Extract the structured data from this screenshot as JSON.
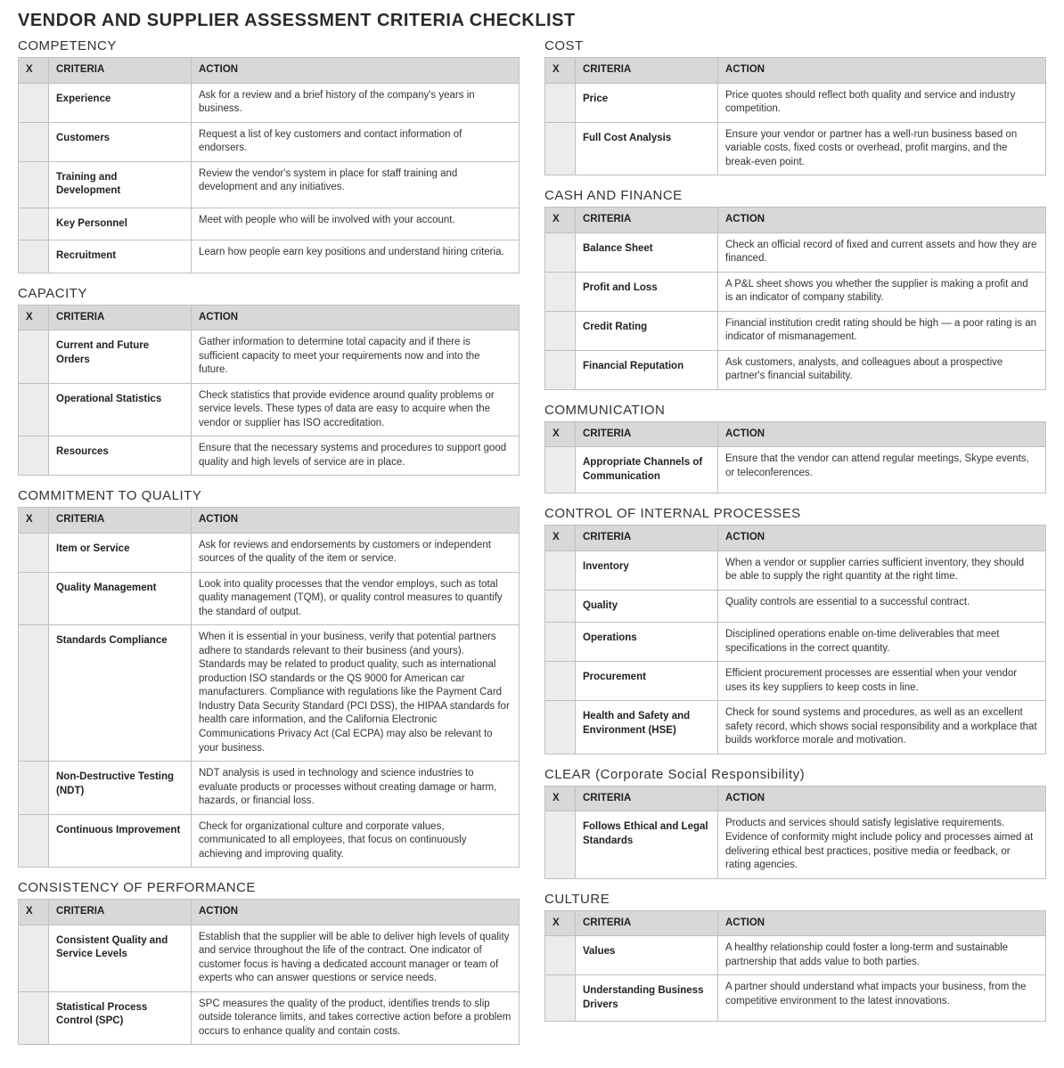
{
  "title": "VENDOR AND SUPPLIER ASSESSMENT CRITERIA CHECKLIST",
  "headers": {
    "x": "X",
    "criteria": "CRITERIA",
    "action": "ACTION"
  },
  "left": [
    {
      "title": "COMPETENCY",
      "rows": [
        {
          "criteria": "Experience",
          "action": "Ask for a review and a brief history of the company's years in business."
        },
        {
          "criteria": "Customers",
          "action": "Request a list of key customers and contact information of endorsers."
        },
        {
          "criteria": "Training and Development",
          "action": "Review the vendor's system in place for staff training and development and any initiatives."
        },
        {
          "criteria": "Key Personnel",
          "action": "Meet with people who will be involved with your account."
        },
        {
          "criteria": "Recruitment",
          "action": "Learn how people earn key positions and understand hiring criteria."
        }
      ]
    },
    {
      "title": "CAPACITY",
      "rows": [
        {
          "criteria": "Current and Future Orders",
          "action": "Gather information to determine total capacity and if there is sufficient capacity to meet your requirements now and into the future."
        },
        {
          "criteria": "Operational Statistics",
          "action": "Check statistics that provide evidence around quality problems or service levels. These types of data are easy to acquire when the vendor or supplier has ISO accreditation."
        },
        {
          "criteria": "Resources",
          "action": "Ensure that the necessary systems and procedures to support good quality and high levels of service are in place."
        }
      ]
    },
    {
      "title": "COMMITMENT TO QUALITY",
      "rows": [
        {
          "criteria": "Item or Service",
          "action": "Ask for reviews and endorsements by customers or independent sources of the quality of the item or service."
        },
        {
          "criteria": "Quality Management",
          "action": "Look into quality processes that the vendor employs, such as total quality management (TQM), or quality control measures to quantify the standard of output."
        },
        {
          "criteria": "Standards Compliance",
          "action": "When it is essential in your business, verify that potential partners adhere to standards relevant to their business (and yours). Standards may be related to product quality, such as international production ISO standards or the QS 9000 for American car manufacturers. Compliance with regulations like the Payment Card Industry Data Security Standard (PCI DSS), the HIPAA standards for health care information, and the California Electronic Communications Privacy Act (Cal ECPA) may also be relevant to your business."
        },
        {
          "criteria": "Non-Destructive Testing (NDT)",
          "action": "NDT analysis is used in technology and science industries to evaluate products or processes without creating damage or harm, hazards, or financial loss."
        },
        {
          "criteria": "Continuous Improvement",
          "action": "Check for organizational culture and corporate values, communicated to all employees, that focus on continuously achieving and improving quality."
        }
      ]
    },
    {
      "title": "CONSISTENCY OF PERFORMANCE",
      "rows": [
        {
          "criteria": "Consistent Quality and Service Levels",
          "action": "Establish that the supplier will be able to deliver high levels of quality and service throughout the life of the contract. One indicator of customer focus is having a dedicated account manager or team of experts who can answer questions or service needs."
        },
        {
          "criteria": "Statistical Process Control (SPC)",
          "action": "SPC measures the quality of the product, identifies trends to slip outside tolerance limits, and takes corrective action before a problem occurs to enhance quality and contain costs."
        }
      ]
    }
  ],
  "right": [
    {
      "title": "COST",
      "rows": [
        {
          "criteria": "Price",
          "action": "Price quotes should reflect both quality and service and industry competition."
        },
        {
          "criteria": "Full Cost Analysis",
          "action": "Ensure your vendor or partner has a well-run business based on variable costs, fixed costs or overhead, profit margins, and the break-even point."
        }
      ]
    },
    {
      "title": "CASH AND FINANCE",
      "rows": [
        {
          "criteria": "Balance Sheet",
          "action": "Check an official record of fixed and current assets and how they are financed."
        },
        {
          "criteria": "Profit and Loss",
          "action": "A P&L sheet shows you whether the supplier is making a profit and is an indicator of company stability."
        },
        {
          "criteria": "Credit Rating",
          "action": "Financial institution credit rating should be high — a poor rating is an indicator of mismanagement."
        },
        {
          "criteria": "Financial Reputation",
          "action": "Ask customers, analysts, and colleagues about a prospective partner's financial suitability."
        }
      ]
    },
    {
      "title": "COMMUNICATION",
      "rows": [
        {
          "criteria": "Appropriate Channels of Communication",
          "action": "Ensure that the vendor can attend regular meetings, Skype events, or teleconferences."
        }
      ]
    },
    {
      "title": "CONTROL OF INTERNAL PROCESSES",
      "rows": [
        {
          "criteria": "Inventory",
          "action": "When a vendor or supplier carries sufficient inventory, they should be able to supply the right quantity at the right time."
        },
        {
          "criteria": "Quality",
          "action": "Quality controls are essential to a successful contract."
        },
        {
          "criteria": "Operations",
          "action": "Disciplined operations enable on-time deliverables that meet specifications in the correct quantity."
        },
        {
          "criteria": "Procurement",
          "action": "Efficient procurement processes are essential when your vendor uses its key suppliers to keep costs in line."
        },
        {
          "criteria": "Health and Safety and Environment (HSE)",
          "action": "Check for sound systems and procedures, as well as an excellent safety record, which shows social responsibility and a workplace that builds workforce morale and motivation."
        }
      ]
    },
    {
      "title": "CLEAR (Corporate Social Responsibility)",
      "rows": [
        {
          "criteria": "Follows Ethical and Legal Standards",
          "action": "Products and services should satisfy legislative requirements. Evidence of conformity might include policy and processes aimed at delivering ethical best practices, positive media or feedback, or rating agencies."
        }
      ]
    },
    {
      "title": "CULTURE",
      "rows": [
        {
          "criteria": "Values",
          "action": "A healthy relationship could foster a long-term and sustainable partnership that adds value to both parties."
        },
        {
          "criteria": "Understanding Business Drivers",
          "action": "A partner should understand what impacts your business, from the competitive environment to the latest innovations."
        }
      ]
    }
  ]
}
